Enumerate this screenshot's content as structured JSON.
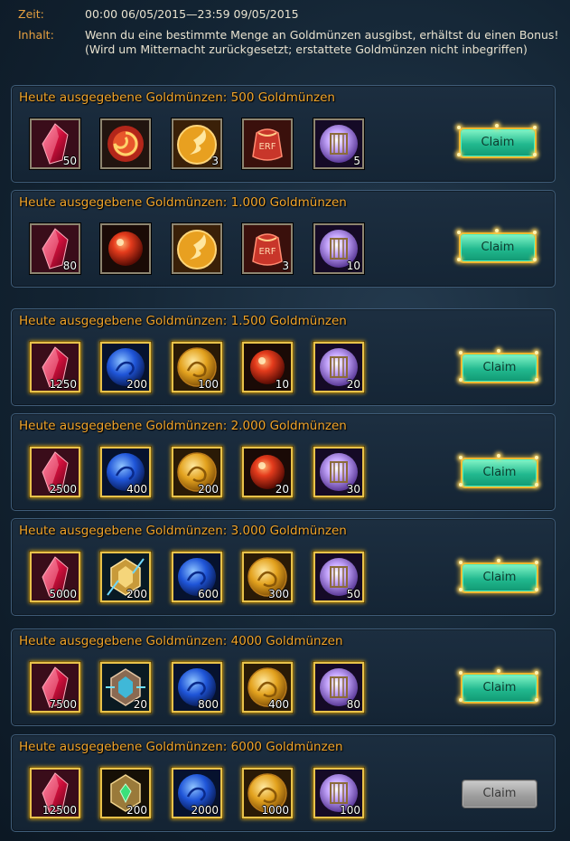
{
  "header": {
    "zeit_label": "Zeit:",
    "zeit_value": "00:00 06/05/2015—23:59 09/05/2015",
    "inhalt_label": "Inhalt:",
    "inhalt_value": "Wenn du eine bestimmte Menge an Goldmünzen ausgibst, erhältst du einen Bonus! (Wird um Mitternacht zurückgesetzt; erstattete Goldmünzen nicht inbegriffen)"
  },
  "claim_label": "Claim",
  "tiers": [
    {
      "title": "Heute ausgegebene Goldmünzen: 500 Goldmünzen",
      "claim_enabled": true,
      "items": [
        {
          "icon": "red-gem-icon",
          "qty": "50"
        },
        {
          "icon": "red-swirl-orb-icon",
          "qty": ""
        },
        {
          "icon": "gold-coin-icon",
          "qty": "3"
        },
        {
          "icon": "exp-pouch-icon",
          "qty": ""
        },
        {
          "icon": "purple-cage-orb-icon",
          "qty": "5"
        }
      ]
    },
    {
      "title": "Heute ausgegebene Goldmünzen: 1.000 Goldmünzen",
      "claim_enabled": true,
      "items": [
        {
          "icon": "red-gem-icon",
          "qty": "80"
        },
        {
          "icon": "red-orb-icon",
          "qty": ""
        },
        {
          "icon": "gold-coin-icon",
          "qty": ""
        },
        {
          "icon": "exp-pouch-icon",
          "qty": "3"
        },
        {
          "icon": "purple-cage-orb-icon",
          "qty": "10"
        }
      ]
    },
    {
      "title": "Heute ausgegebene Goldmünzen: 1.500 Goldmünzen",
      "claim_enabled": true,
      "items": [
        {
          "icon": "red-gem-icon",
          "qty": "1250"
        },
        {
          "icon": "blue-orb-icon",
          "qty": "200"
        },
        {
          "icon": "gold-dragon-coin-icon",
          "qty": "100"
        },
        {
          "icon": "red-orb-icon",
          "qty": "10"
        },
        {
          "icon": "purple-cage-orb-icon",
          "qty": "20"
        }
      ]
    },
    {
      "title": "Heute ausgegebene Goldmünzen: 2.000 Goldmünzen",
      "claim_enabled": true,
      "items": [
        {
          "icon": "red-gem-icon",
          "qty": "2500"
        },
        {
          "icon": "blue-orb-icon",
          "qty": "400"
        },
        {
          "icon": "gold-dragon-coin-icon",
          "qty": "200"
        },
        {
          "icon": "red-orb-icon",
          "qty": "20"
        },
        {
          "icon": "purple-cage-orb-icon",
          "qty": "30"
        }
      ]
    },
    {
      "title": "Heute ausgegebene Goldmünzen: 3.000 Goldmünzen",
      "claim_enabled": true,
      "items": [
        {
          "icon": "red-gem-icon",
          "qty": "5000"
        },
        {
          "icon": "gold-crest-icon",
          "qty": "200"
        },
        {
          "icon": "blue-orb-icon",
          "qty": "600"
        },
        {
          "icon": "gold-dragon-coin-icon",
          "qty": "300"
        },
        {
          "icon": "purple-cage-orb-icon",
          "qty": "50"
        }
      ]
    },
    {
      "title": "Heute ausgegebene Goldmünzen: 4000 Goldmünzen",
      "claim_enabled": true,
      "items": [
        {
          "icon": "red-gem-icon",
          "qty": "7500"
        },
        {
          "icon": "cyan-crest-icon",
          "qty": "20"
        },
        {
          "icon": "blue-orb-icon",
          "qty": "800"
        },
        {
          "icon": "gold-dragon-coin-icon",
          "qty": "400"
        },
        {
          "icon": "purple-cage-orb-icon",
          "qty": "80"
        }
      ]
    },
    {
      "title": "Heute ausgegebene Goldmünzen: 6000 Goldmünzen",
      "claim_enabled": false,
      "items": [
        {
          "icon": "red-gem-icon",
          "qty": "12500"
        },
        {
          "icon": "green-crest-icon",
          "qty": "200"
        },
        {
          "icon": "blue-orb-icon",
          "qty": "2000"
        },
        {
          "icon": "gold-dragon-coin-icon",
          "qty": "1000"
        },
        {
          "icon": "purple-cage-orb-icon",
          "qty": "100"
        }
      ]
    }
  ]
}
